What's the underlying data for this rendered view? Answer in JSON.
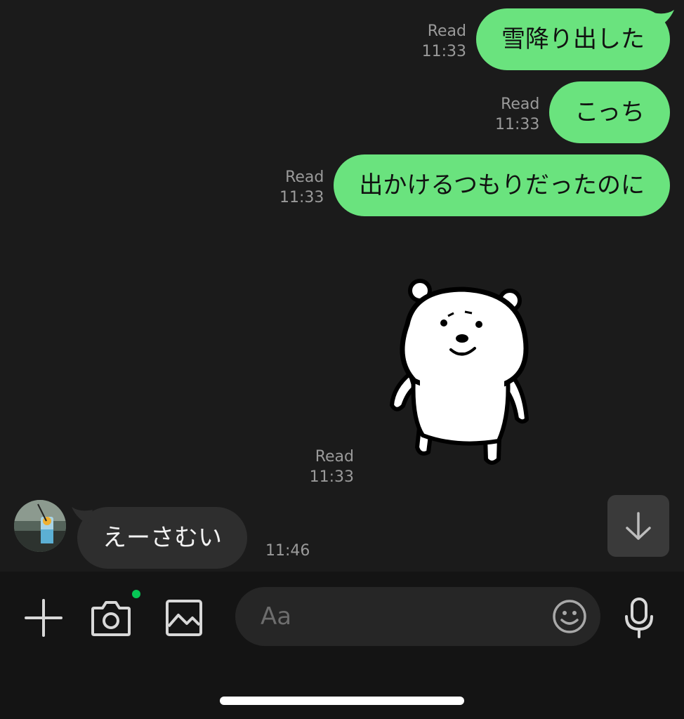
{
  "messages": {
    "outgoing": [
      {
        "text": "雪降り出した",
        "read": "Read",
        "time": "11:33"
      },
      {
        "text": "こっち",
        "read": "Read",
        "time": "11:33"
      },
      {
        "text": "出かけるつもりだったのに",
        "read": "Read",
        "time": "11:33"
      }
    ],
    "sticker": {
      "read": "Read",
      "time": "11:33",
      "icon": "bear-sticker"
    },
    "incoming": {
      "text": "えーさむい",
      "time": "11:46"
    }
  },
  "input_bar": {
    "placeholder": "Aa",
    "icons": [
      "plus-icon",
      "camera-icon",
      "image-icon",
      "emoji-icon",
      "microphone-icon"
    ]
  },
  "colors": {
    "background": "#1b1b1b",
    "outgoing_bubble": "#6ae37e",
    "incoming_bubble": "#2e2e2e",
    "notification_dot": "#06c755"
  }
}
